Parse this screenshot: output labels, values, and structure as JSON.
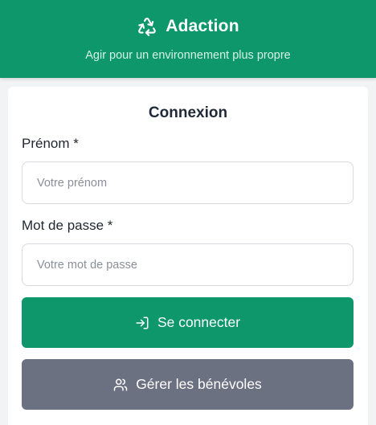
{
  "header": {
    "title": "Adaction",
    "tagline": "Agir pour un environnement plus propre",
    "icon": "recycle-icon"
  },
  "login": {
    "title": "Connexion",
    "firstname_label": "Prénom *",
    "firstname_placeholder": "Votre prénom",
    "firstname_value": "",
    "password_label": "Mot de passe *",
    "password_placeholder": "Votre mot de passe",
    "password_value": "",
    "submit_label": "Se connecter",
    "submit_icon": "login-icon",
    "manage_label": "Gérer les bénévoles",
    "manage_icon": "users-icon"
  },
  "colors": {
    "brand_green": "#0d976a",
    "secondary_gray": "#6c7181",
    "background": "#f1f3f4"
  }
}
